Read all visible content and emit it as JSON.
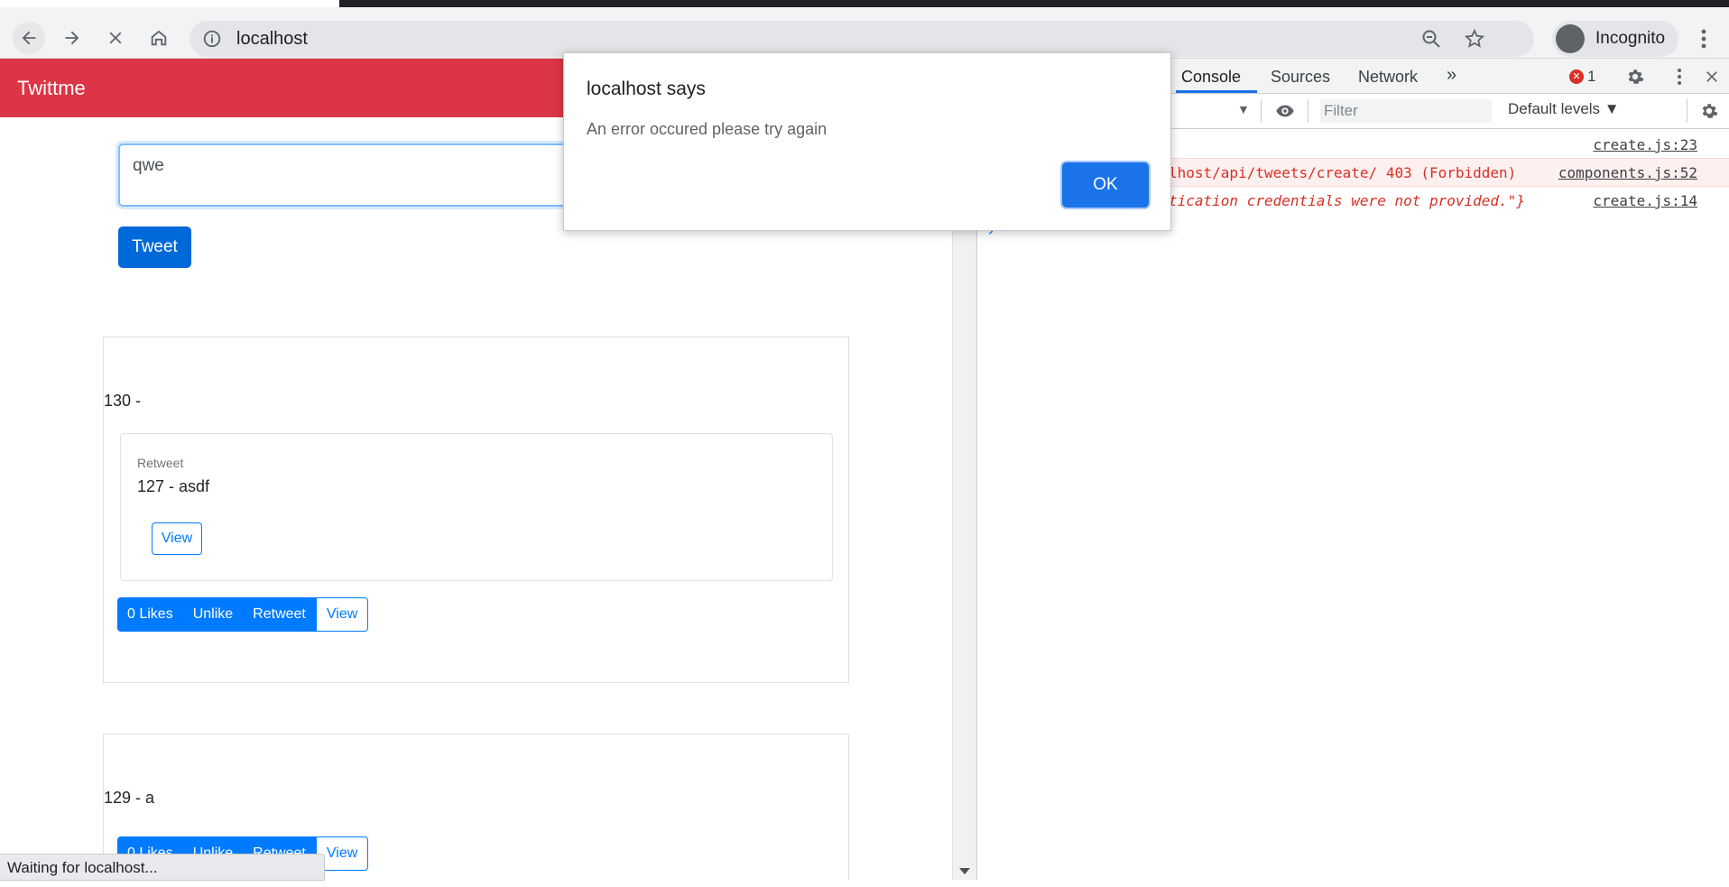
{
  "browser": {
    "url": "localhost",
    "profile_label": "Incognito",
    "status_text": "Waiting for localhost..."
  },
  "page": {
    "brand": "Twittme",
    "tweet_input_value": "qwe",
    "tweet_button": "Tweet",
    "tweets": [
      {
        "text": "130 -",
        "retweet": {
          "label": "Retweet",
          "text": "127 - asdf",
          "view_label": "View"
        },
        "actions": [
          "0 Likes",
          "Unlike",
          "Retweet",
          "View"
        ]
      },
      {
        "text": "129 - a",
        "actions": [
          "0 Likes",
          "Unlike",
          "Retweet",
          "View"
        ]
      }
    ]
  },
  "devtools": {
    "tabs": [
      "Console",
      "Sources",
      "Network",
      "»"
    ],
    "error_count": "1",
    "filter_placeholder": "Filter",
    "levels_label": "Default levels ▼",
    "logs": [
      {
        "message": "",
        "source": "create.js:23"
      },
      {
        "message": "lhost/api/tweets/create/ 403 (Forbidden)",
        "source": "components.js:52"
      },
      {
        "message": "tication credentials were not provided.\"}",
        "source": "create.js:14"
      }
    ]
  },
  "dialog": {
    "title": "localhost says",
    "message": "An error occured please try again",
    "ok_label": "OK"
  }
}
